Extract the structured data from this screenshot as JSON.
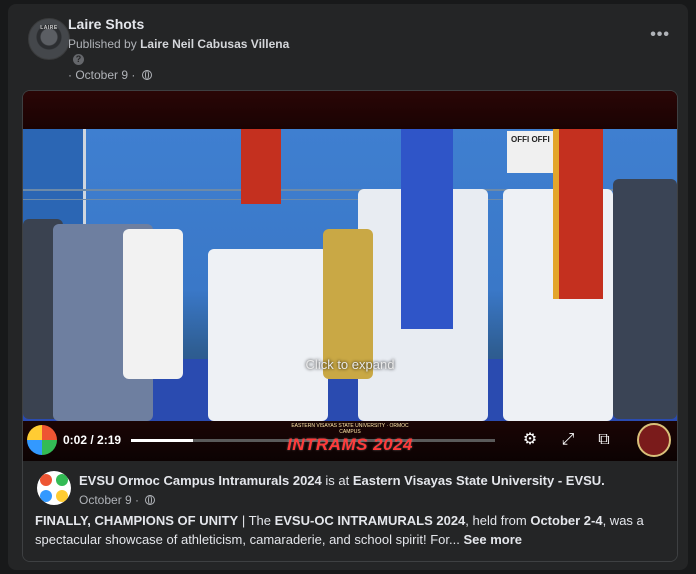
{
  "post": {
    "page_name": "Laire Shots",
    "avatar_text": "LAIRE",
    "published_prefix": "Published by",
    "publisher": "Laire Neil Cabusas Villena",
    "help_icon": "?",
    "date": "· October 9 ·",
    "more_icon": "•••"
  },
  "video": {
    "time": "0:02 / 2:19",
    "progress": 0.015,
    "overlay_text": "Click to expand",
    "banner_top_text": "EASTERN VISAYAS STATE UNIVERSITY · ORMOC CAMPUS",
    "banner_title": "INTRAMS 2024",
    "sign_text": "OFFI OFFI",
    "icons": {
      "settings": "gear-icon",
      "expand": "expand-icon",
      "miniplayer": "miniplayer-icon"
    }
  },
  "shared": {
    "org_name": "EVSU Ormoc Campus Intramurals 2024",
    "is_at": " is at ",
    "location": "Eastern Visayas State University - EVSU.",
    "date": "October 9 ·",
    "desc_bold1": "FINALLY, CHAMPIONS OF UNITY",
    "desc_sep": " | ",
    "desc_text1": " The ",
    "desc_bold2": "EVSU-OC INTRAMURALS 2024",
    "desc_text2": ", held from ",
    "desc_bold3": "October 2-4",
    "desc_text3": ", was a spectacular showcase of athleticism, camaraderie, and school spirit! For...",
    "see_more": "See more"
  },
  "colors": {
    "background": "#18191a",
    "card": "#242526",
    "flag_blue": "#2f55c8",
    "flag_red": "#c4301f"
  }
}
